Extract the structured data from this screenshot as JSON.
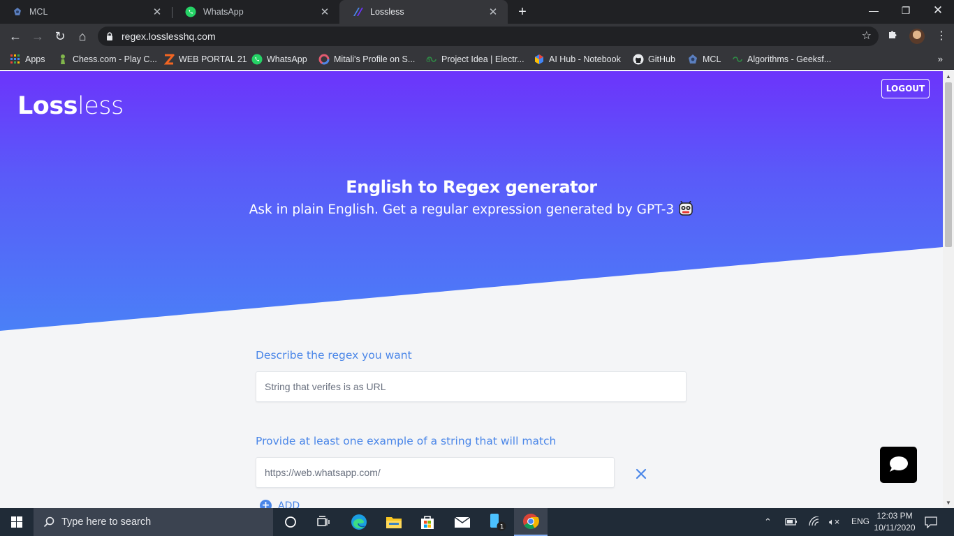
{
  "browser": {
    "tabs": [
      {
        "title": "MCL",
        "active": false
      },
      {
        "title": "WhatsApp",
        "active": false
      },
      {
        "title": "Lossless",
        "active": true
      }
    ],
    "address": "regex.losslesshq.com",
    "bookmarks": [
      {
        "label": "Apps",
        "icon": "apps-grid-icon"
      },
      {
        "label": "Chess.com - Play C...",
        "icon": "chess-pawn-icon"
      },
      {
        "label": "WEB PORTAL 21",
        "icon": "web-portal-icon"
      },
      {
        "label": "WhatsApp",
        "icon": "whatsapp-icon"
      },
      {
        "label": "Mitali's Profile on S...",
        "icon": "profile-ring-icon"
      },
      {
        "label": "Project Idea | Electr...",
        "icon": "geeksforgeeks-icon"
      },
      {
        "label": "AI Hub - Notebook",
        "icon": "ai-hub-icon"
      },
      {
        "label": "GitHub",
        "icon": "github-icon"
      },
      {
        "label": "MCL",
        "icon": "mcl-icon"
      },
      {
        "label": "Algorithms - Geeksf...",
        "icon": "geeksforgeeks-icon"
      }
    ],
    "more_bookmarks": "»"
  },
  "page": {
    "logo_bold": "Loss",
    "logo_light": "less",
    "logout": "LOGOUT",
    "title": "English to Regex generator",
    "subtitle": "Ask in plain English. Get a regular expression generated by GPT-3",
    "describe_label": "Describe the regex you want",
    "describe_placeholder": "String that verifes is as URL",
    "example_label": "Provide at least one example of a string that will match",
    "example_placeholder": "https://web.whatsapp.com/",
    "add_label": "ADD"
  },
  "taskbar": {
    "search_placeholder": "Type here to search",
    "language": "ENG",
    "time": "12:03 PM",
    "date": "10/11/2020",
    "badge_count": "1"
  },
  "colors": {
    "hero_top": "#6c34fb",
    "hero_bottom": "#4a80f7",
    "accent": "#4a86e8"
  }
}
